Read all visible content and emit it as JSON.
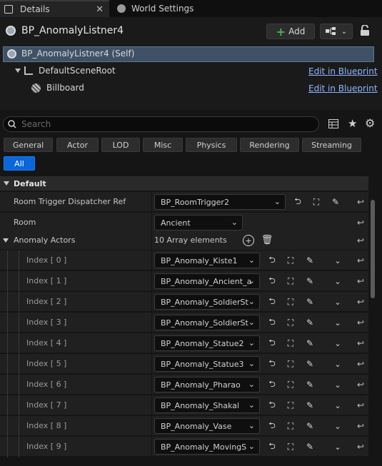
{
  "tabs": [
    {
      "label": "Details",
      "icon": "details-icon",
      "active": true
    },
    {
      "label": "World Settings",
      "icon": "globe-icon",
      "active": false
    }
  ],
  "header": {
    "title": "BP_AnomalyListner4",
    "add_label": "Add"
  },
  "components": {
    "self_label": "BP_AnomalyListner4 (Self)",
    "items": [
      {
        "label": "DefaultSceneRoot",
        "link": "Edit in Blueprint"
      },
      {
        "label": "Billboard",
        "link": "Edit in Blueprint"
      }
    ]
  },
  "search": {
    "placeholder": "Search"
  },
  "filters": [
    "General",
    "Actor",
    "LOD",
    "Misc",
    "Physics",
    "Rendering",
    "Streaming",
    "All"
  ],
  "active_filter": "All",
  "section": {
    "label": "Default"
  },
  "properties": {
    "room_trigger": {
      "label": "Room Trigger Dispatcher Ref",
      "value": "BP_RoomTrigger2"
    },
    "room": {
      "label": "Room",
      "value": "Ancient"
    },
    "anomaly_actors": {
      "label": "Anomaly Actors",
      "summary": "10 Array elements"
    }
  },
  "array_items": [
    {
      "index": "Index [ 0 ]",
      "value": "BP_Anomaly_Kiste1"
    },
    {
      "index": "Index [ 1 ]",
      "value": "BP_Anomaly_Ancient_a"
    },
    {
      "index": "Index [ 2 ]",
      "value": "BP_Anomaly_SoldierSt"
    },
    {
      "index": "Index [ 3 ]",
      "value": "BP_Anomaly_SoldierSt"
    },
    {
      "index": "Index [ 4 ]",
      "value": "BP_Anomaly_Statue2"
    },
    {
      "index": "Index [ 5 ]",
      "value": "BP_Anomaly_Statue3"
    },
    {
      "index": "Index [ 6 ]",
      "value": "BP_Anomaly_Pharao"
    },
    {
      "index": "Index [ 7 ]",
      "value": "BP_Anomaly_Shakal"
    },
    {
      "index": "Index [ 8 ]",
      "value": "BP_Anomaly_Vase"
    },
    {
      "index": "Index [ 9 ]",
      "value": "BP_Anomaly_MovingS"
    }
  ],
  "colors": {
    "accent": "#0a66d9",
    "link": "#8fb6ff",
    "selection": "#3f5166",
    "add_plus": "#4caf50"
  }
}
